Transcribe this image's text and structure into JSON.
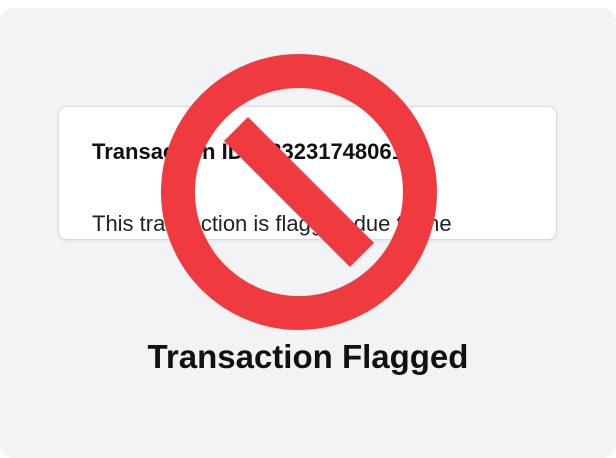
{
  "card": {
    "transaction_id": "Transaction ID: 0832317480618",
    "message": "This transaction is flagged due to the"
  },
  "status": {
    "caption": "Transaction Flagged",
    "icon": "prohibited-icon",
    "icon_color": "#ef3b3f"
  }
}
